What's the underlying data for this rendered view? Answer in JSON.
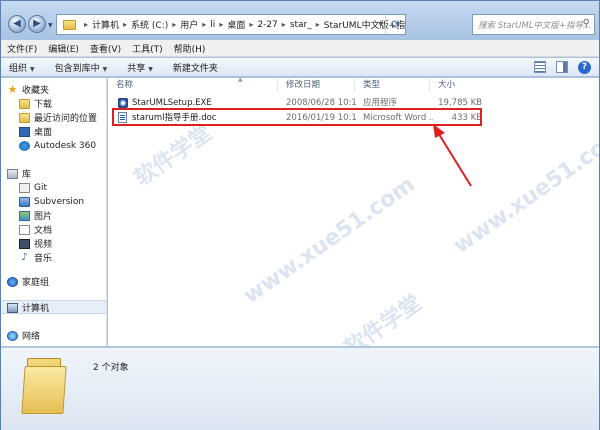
{
  "window": {
    "breadcrumb": [
      "计算机",
      "系统 (C:)",
      "用户",
      "li",
      "桌面",
      "2-27",
      "star_",
      "StarUML中文版+指导手册"
    ],
    "search_placeholder": "搜索 StarUML中文版+指导..."
  },
  "menubar": {
    "items": [
      "文件(F)",
      "编辑(E)",
      "查看(V)",
      "工具(T)",
      "帮助(H)"
    ]
  },
  "commandbar": {
    "organize": "组织",
    "include_library": "包含到库中",
    "share": "共享",
    "new_folder": "新建文件夹"
  },
  "navpane": {
    "favorites": "收藏夹",
    "downloads": "下载",
    "recent": "最近访问的位置",
    "desktop": "桌面",
    "autodesk": "Autodesk 360",
    "libraries": "库",
    "git": "Git",
    "subversion": "Subversion",
    "pictures": "图片",
    "documents": "文档",
    "videos": "视频",
    "music": "音乐",
    "homegroup": "家庭组",
    "computer": "计算机",
    "network": "网络"
  },
  "filelist": {
    "columns": {
      "name": "名称",
      "date": "修改日期",
      "type": "类型",
      "size": "大小"
    },
    "rows": [
      {
        "name": "StarUMLSetup.EXE",
        "date": "2008/06/28 10:1...",
        "type": "应用程序",
        "size": "19,785 KB"
      },
      {
        "name": "staruml指导手册.doc",
        "date": "2016/01/19 10:1...",
        "type": "Microsoft Word ...",
        "size": "433 KB"
      }
    ]
  },
  "details": {
    "count_text": "2 个对象"
  },
  "colors": {
    "highlight": "#e02020",
    "chrome": "#b7cde9"
  }
}
